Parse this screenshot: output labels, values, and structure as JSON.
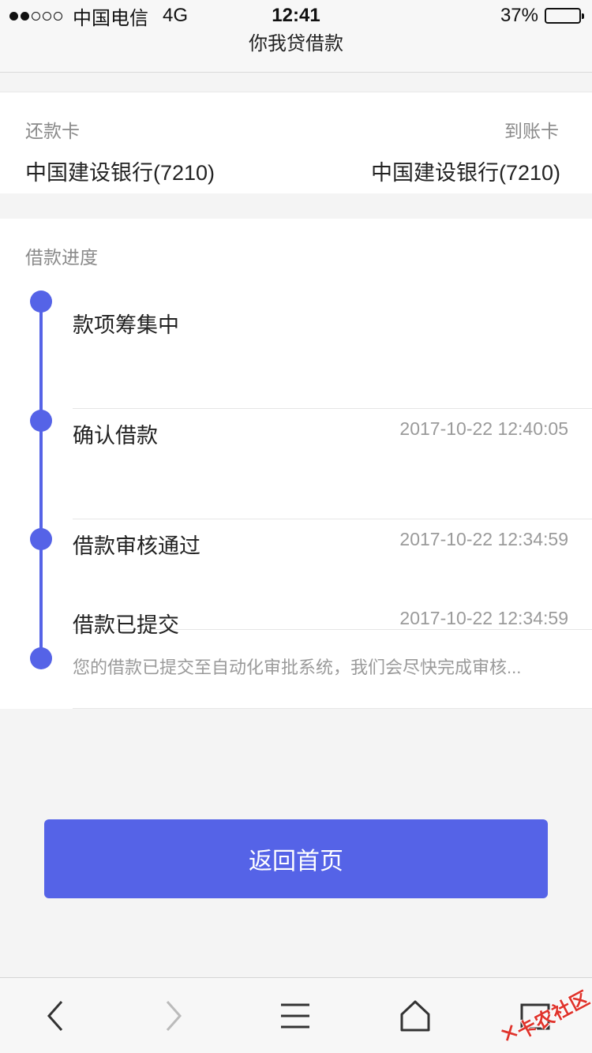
{
  "status_bar": {
    "signal_dots_filled": 2,
    "signal_dots_total": 5,
    "carrier": "中国电信",
    "network": "4G",
    "time": "12:41",
    "battery_percent": "37%",
    "battery_level": 0.37
  },
  "header": {
    "title": "你我贷借款"
  },
  "cards": {
    "repay_label": "还款卡",
    "repay_value": "中国建设银行(7210)",
    "receive_label": "到账卡",
    "receive_value": "中国建设银行(7210)"
  },
  "progress": {
    "title": "借款进度",
    "steps": [
      {
        "title": "款项筹集中",
        "time": ""
      },
      {
        "title": "确认借款",
        "time": "2017-10-22 12:40:05"
      },
      {
        "title": "借款审核通过",
        "time": "2017-10-22 12:34:59"
      },
      {
        "title": "借款已提交",
        "time": "2017-10-22 12:34:59",
        "desc": "您的借款已提交至自动化审批系统，我们会尽快完成审核..."
      }
    ]
  },
  "actions": {
    "home_button": "返回首页"
  },
  "toolbar": {
    "icons": [
      "back-icon",
      "forward-icon",
      "menu-icon",
      "home-icon",
      "tabs-icon"
    ]
  },
  "watermark": {
    "text": "卡农社区"
  },
  "colors": {
    "accent": "#5563e7",
    "watermark": "#e0332b"
  }
}
